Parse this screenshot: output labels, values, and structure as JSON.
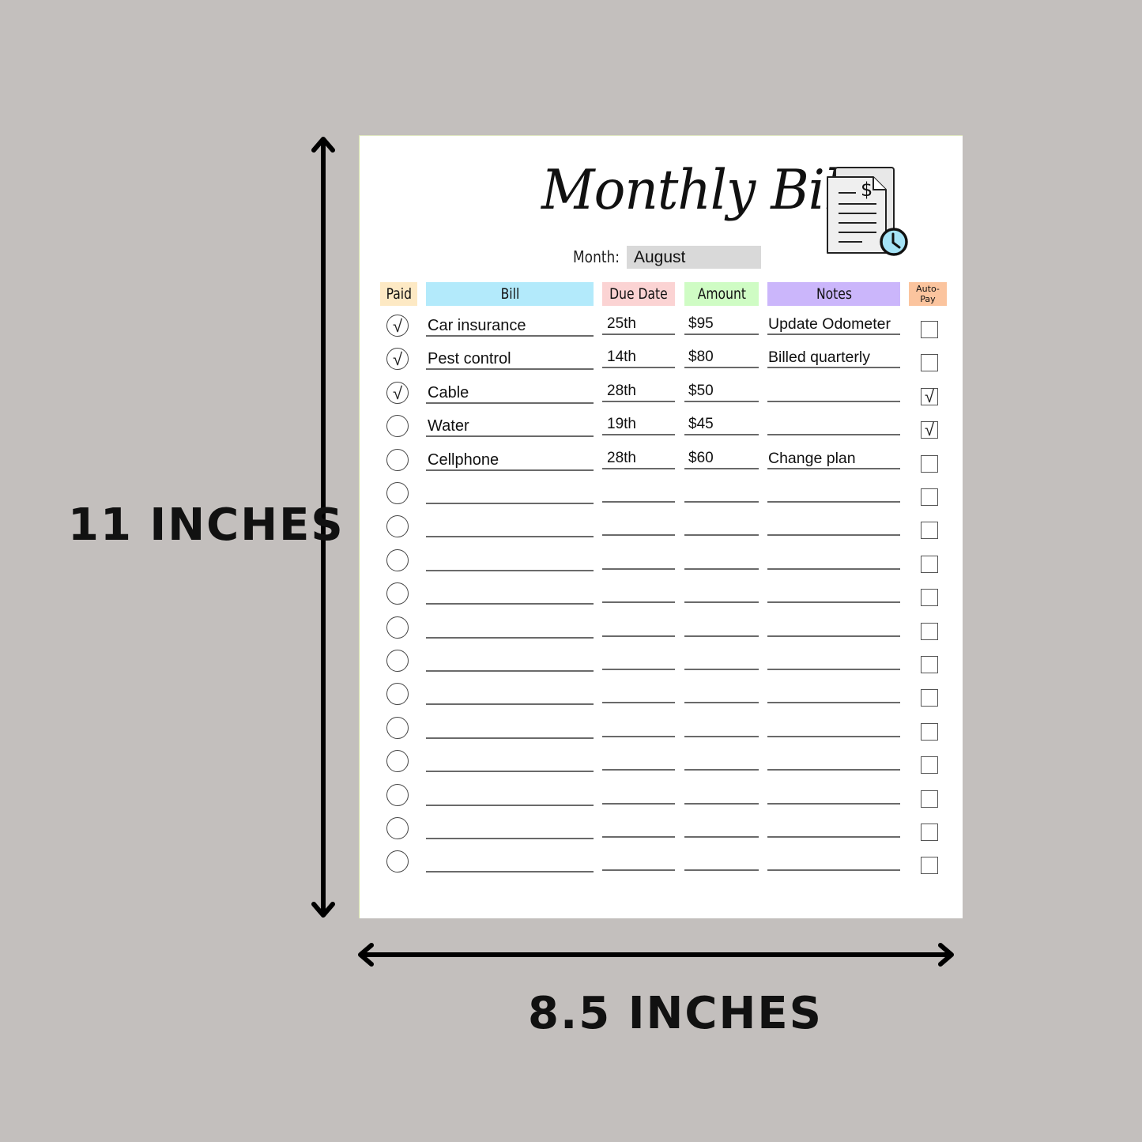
{
  "dimensions": {
    "height_label": "11 INCHES",
    "width_label": "8.5 INCHES"
  },
  "sheet": {
    "title": "Monthly Bills",
    "month_label": "Month:",
    "month_value": "August",
    "icon": "bill-document-clock-icon",
    "colors": {
      "paid": "#fde9c4",
      "bill": "#b3eafb",
      "due_date": "#fbd3d3",
      "amount": "#cffcc4",
      "notes": "#cbb6fb",
      "autopay": "#fbc49e",
      "clock": "#a5e3f6"
    },
    "headers": {
      "paid": "Paid",
      "bill": "Bill",
      "due_date": "Due Date",
      "amount": "Amount",
      "notes": "Notes",
      "autopay_1": "Auto-",
      "autopay_2": "Pay"
    },
    "rows": [
      {
        "paid": true,
        "bill": "Car insurance",
        "due": "25th",
        "amount": "$95",
        "notes": "Update Odometer",
        "autopay": false
      },
      {
        "paid": true,
        "bill": "Pest control",
        "due": "14th",
        "amount": "$80",
        "notes": "Billed quarterly",
        "autopay": false
      },
      {
        "paid": true,
        "bill": "Cable",
        "due": "28th",
        "amount": "$50",
        "notes": "",
        "autopay": true
      },
      {
        "paid": false,
        "bill": "Water",
        "due": "19th",
        "amount": "$45",
        "notes": "",
        "autopay": true
      },
      {
        "paid": false,
        "bill": "Cellphone",
        "due": "28th",
        "amount": "$60",
        "notes": "Change plan",
        "autopay": false
      },
      {
        "paid": false,
        "bill": "",
        "due": "",
        "amount": "",
        "notes": "",
        "autopay": false
      },
      {
        "paid": false,
        "bill": "",
        "due": "",
        "amount": "",
        "notes": "",
        "autopay": false
      },
      {
        "paid": false,
        "bill": "",
        "due": "",
        "amount": "",
        "notes": "",
        "autopay": false
      },
      {
        "paid": false,
        "bill": "",
        "due": "",
        "amount": "",
        "notes": "",
        "autopay": false
      },
      {
        "paid": false,
        "bill": "",
        "due": "",
        "amount": "",
        "notes": "",
        "autopay": false
      },
      {
        "paid": false,
        "bill": "",
        "due": "",
        "amount": "",
        "notes": "",
        "autopay": false
      },
      {
        "paid": false,
        "bill": "",
        "due": "",
        "amount": "",
        "notes": "",
        "autopay": false
      },
      {
        "paid": false,
        "bill": "",
        "due": "",
        "amount": "",
        "notes": "",
        "autopay": false
      },
      {
        "paid": false,
        "bill": "",
        "due": "",
        "amount": "",
        "notes": "",
        "autopay": false
      },
      {
        "paid": false,
        "bill": "",
        "due": "",
        "amount": "",
        "notes": "",
        "autopay": false
      },
      {
        "paid": false,
        "bill": "",
        "due": "",
        "amount": "",
        "notes": "",
        "autopay": false
      },
      {
        "paid": false,
        "bill": "",
        "due": "",
        "amount": "",
        "notes": "",
        "autopay": false
      }
    ],
    "check_glyph": "√"
  }
}
